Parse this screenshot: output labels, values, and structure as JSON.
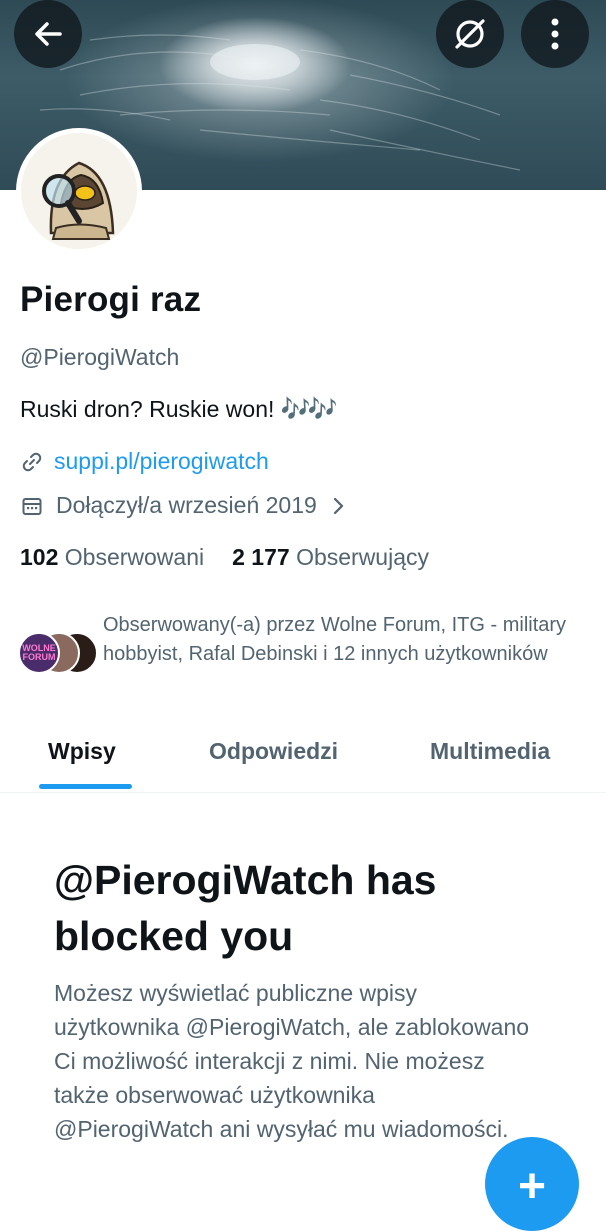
{
  "header": {
    "back_icon": "arrow-left-icon",
    "grok_icon": "slashed-circle-icon",
    "more_icon": "vertical-dots-icon"
  },
  "profile": {
    "name": "Pierogi raz",
    "handle": "@PierogiWatch",
    "bio_text": "Ruski dron? Ruskie won!",
    "bio_emoji": "🎶🎶",
    "link": "suppi.pl/pierogiwatch",
    "joined": "Dołączył/a wrzesień 2019"
  },
  "stats": {
    "following_count": "102",
    "following_label": "Obserwowani",
    "followers_count": "2 177",
    "followers_label": "Obserwujący"
  },
  "followed_by": {
    "text": "Obserwowany(-a) przez Wolne Forum, ITG - military hobbyist, Rafal Debinski i 12 innych użytkowników",
    "avatar_label": "WOLNE FORUM"
  },
  "tabs": [
    {
      "label": "Wpisy",
      "active": true
    },
    {
      "label": "Odpowiedzi",
      "active": false
    },
    {
      "label": "Multimedia",
      "active": false
    }
  ],
  "blocked": {
    "title": "@PierogiWatch has blocked you",
    "description": "Możesz wyświetlać publiczne wpisy użytkownika @PierogiWatch, ale zablokowano Ci możliwość interakcji z nimi. Nie możesz także obserwować użytkownika @PierogiWatch ani wysyłać mu wiadomości."
  },
  "fab": {
    "label": "+"
  },
  "colors": {
    "accent": "#1d9bf0",
    "muted": "#536471",
    "text": "#0f1419"
  }
}
